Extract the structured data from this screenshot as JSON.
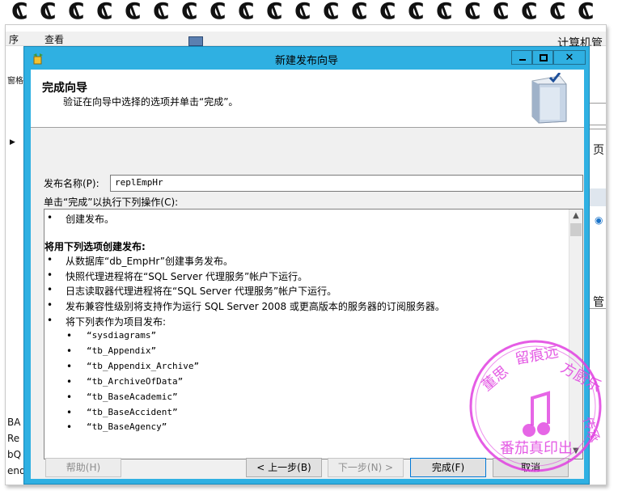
{
  "background_app": {
    "menu_items": [
      "序",
      "查看"
    ],
    "window_title": "计算机管",
    "left_fragments": [
      "窗格",
      "BA",
      "Re",
      "bQ",
      "endData"
    ],
    "right_fragments": [
      "页",
      "管"
    ]
  },
  "dialog": {
    "title": "新建发布向导",
    "header_title": "完成向导",
    "header_subtitle": "验证在向导中选择的选项并单击“完成”。",
    "name_label": "发布名称(P):",
    "name_value": "replEmpHr",
    "actions_label": "单击“完成”以执行下列操作(C):",
    "summary": {
      "first_bullet": "创建发布。",
      "section_heading": "将用下列选项创建发布:",
      "bullets": [
        "从数据库“db_EmpHr”创建事务发布。",
        "快照代理进程将在“SQL Server 代理服务”帐户下运行。",
        "日志读取器代理进程将在“SQL Server 代理服务”帐户下运行。",
        "发布兼容性级别将支持作为运行 SQL Server 2008 或更高版本的服务器的订阅服务器。",
        "将下列表作为项目发布:"
      ],
      "tables": [
        "“sysdiagrams”",
        "“tb_Appendix”",
        "“tb_Appendix_Archive”",
        "“tb_ArchiveOfData”",
        "“tb_BaseAcademic”",
        "“tb_BaseAccident”",
        "“tb_BaseAgency”"
      ]
    },
    "buttons": {
      "help": "帮助(H)",
      "back": "< 上一步(B)",
      "next": "下一步(N) >",
      "finish": "完成(F)",
      "cancel": "取消"
    }
  },
  "stamp_text": "董思留痕远方厨乐传承 番茄真印出",
  "colors": {
    "titlebar": "#2fb0e2",
    "stamp": "#e040e0"
  }
}
